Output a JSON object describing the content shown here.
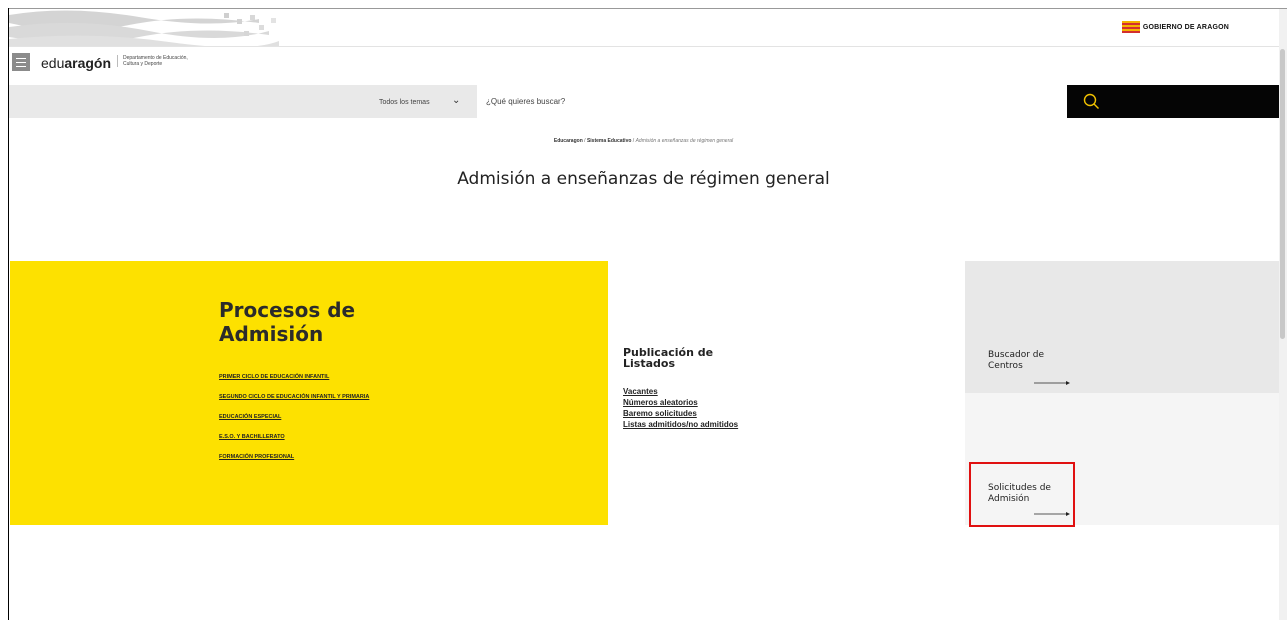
{
  "header": {
    "gov_logo_text": "GOBIERNO DE ARAGON",
    "brand_light": "edu",
    "brand_bold": "aragón",
    "brand_subtitle": "Departamento de Educación, Cultura y Deporte"
  },
  "search": {
    "topic_selected": "Todos los temas",
    "placeholder": "¿Qué quieres buscar?"
  },
  "breadcrumb": {
    "items": [
      "Educaragon",
      "Sistema Educativo"
    ],
    "current": "Admisión a enseñanzas de régimen general",
    "separator": "/"
  },
  "page_title": "Admisión a enseñanzas de régimen general",
  "procesos": {
    "title": "Procesos de Admisión",
    "links": [
      "PRIMER CICLO DE EDUCACIÓN INFANTIL",
      "SEGUNDO CICLO DE EDUCACIÓN INFANTIL Y PRIMARIA",
      "EDUCACIÓN ESPECIAL",
      "E.S.O. Y BACHILLERATO",
      "FORMACIÓN PROFESIONAL"
    ]
  },
  "listados": {
    "title": "Publicación de Listados",
    "links": [
      "Vacantes",
      "Números aleatorios",
      "Baremo solicitudes",
      "Listas admitidos/no admitidos"
    ]
  },
  "cards": [
    {
      "title": "Buscador de Centros",
      "icon": "arrow-right-icon"
    },
    {
      "title": "Solicitudes de Admisión",
      "icon": "arrow-right-icon"
    }
  ],
  "colors": {
    "accent_yellow": "#fde100",
    "highlight_red": "#e01010",
    "search_icon": "#f2c200"
  }
}
